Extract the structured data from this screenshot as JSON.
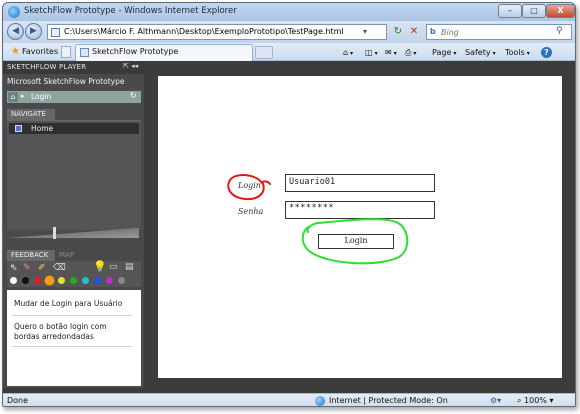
{
  "window": {
    "title": "SketchFlow Prototype - Windows Internet Explorer",
    "min_label": "–",
    "max_label": "□",
    "close_label": "X"
  },
  "toolbar": {
    "back_label": "◀",
    "forward_label": "▶",
    "address": "C:\\Users\\Márcio F. Althmann\\Desktop\\ExemploPrototipo\\TestPage.html",
    "dropdown_label": "▾",
    "refresh_label": "↻",
    "stop_label": "✕",
    "search_placeholder": "Bing",
    "search_logo": "b",
    "search_icon": "⚲"
  },
  "favorites": {
    "label": "Favorites",
    "tab_title": "SketchFlow Prototype",
    "commands": [
      "Page",
      "Safety",
      "Tools",
      "?"
    ]
  },
  "sketchflow": {
    "player_title": "SKETCHFLOW PLAYER",
    "player_controls": "⇱ ◂◂",
    "project_name": "Microsoft SketchFlow Prototype",
    "current_screen": "Login",
    "navigate_tab": "NAVIGATE",
    "nav_items": [
      "Home"
    ],
    "feedback_tab": "FEEDBACK",
    "map_tab": "MAP",
    "feedback_items": [
      "Mudar de Login para Usuário",
      "Quero o botão login com bordas arredondadas"
    ],
    "palette_colors": [
      "#ffffff",
      "#111111",
      "#e02020",
      "#f0a020",
      "#f0e020",
      "#20b020",
      "#20c0e0",
      "#2050e0",
      "#c030c0",
      "#888888"
    ]
  },
  "prototype": {
    "login_label": "Login",
    "password_label": "Senha",
    "username_value": "Usuario01",
    "password_value": "********",
    "login_button": "Login",
    "annotation_colors": {
      "circle": "#e01818",
      "highlight": "#2ee02e"
    }
  },
  "status": {
    "text": "Done",
    "zone": "Internet | Protected Mode: On",
    "zoom": "100%"
  }
}
